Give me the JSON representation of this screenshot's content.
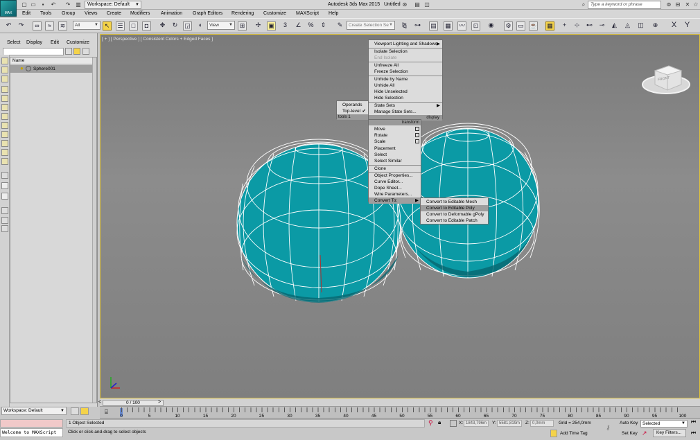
{
  "app": {
    "title": "Autodesk 3ds Max 2015",
    "document": "Untitled",
    "logo_text": "MAX",
    "workspace": "Workspace: Default",
    "keyword_placeholder": "Type a keyword or phrase"
  },
  "menubar": [
    "Edit",
    "Tools",
    "Group",
    "Views",
    "Create",
    "Modifiers",
    "Animation",
    "Graph Editors",
    "Rendering",
    "Customize",
    "MAXScript",
    "Help"
  ],
  "toolbar": {
    "selection_filter": "All",
    "reference_coord": "View",
    "named_selection_placeholder": "Create Selection Se",
    "snap_number": "3"
  },
  "scene_explorer": {
    "menu": [
      "Select",
      "Display",
      "Edit",
      "Customize"
    ],
    "column_name": "Name",
    "objects": [
      "Sphere001"
    ]
  },
  "viewport": {
    "label": "[ + ] [ Perspective ] [ Consistent Colors + Edged Faces ]",
    "viewcube_face": "FRONT",
    "object_color": "#0b9aa5",
    "edge_color": "#ffffff"
  },
  "quad_menu": {
    "display_items": [
      {
        "label": "Viewport Lighting and Shadows",
        "submenu": true
      },
      {
        "label": "Isolate Selection"
      },
      {
        "label": "End Isolate",
        "disabled": true
      },
      {
        "label": "Unfreeze All"
      },
      {
        "label": "Freeze Selection"
      },
      {
        "label": "Unhide by Name"
      },
      {
        "label": "Unhide All"
      },
      {
        "label": "Hide Unselected"
      },
      {
        "label": "Hide Selection"
      },
      {
        "label": "State Sets",
        "submenu": true
      },
      {
        "label": "Manage State Sets..."
      }
    ],
    "tools1_items": [
      {
        "label": "Operands"
      },
      {
        "label": "Top-level",
        "checked": true
      }
    ],
    "tools1_title": "tools 1",
    "display_title": "display",
    "transform_title": "transform",
    "transform_items": [
      {
        "label": "Move"
      },
      {
        "label": "Rotate"
      },
      {
        "label": "Scale"
      },
      {
        "label": "Placement"
      },
      {
        "label": "Select"
      },
      {
        "label": "Select Similar"
      },
      {
        "label": "Clone"
      },
      {
        "label": "Object Properties..."
      },
      {
        "label": "Curve Editor..."
      },
      {
        "label": "Dope Sheet..."
      },
      {
        "label": "Wire Parameters..."
      },
      {
        "label": "Convert To:",
        "submenu": true
      }
    ],
    "convert_items": [
      {
        "label": "Convert to Editable Mesh"
      },
      {
        "label": "Convert to Editable Poly"
      },
      {
        "label": "Convert to Deformable gPoly"
      },
      {
        "label": "Convert to Editable Patch"
      }
    ]
  },
  "timeline": {
    "frame_display": "0 / 100",
    "ticks": [
      "0",
      "5",
      "10",
      "15",
      "20",
      "25",
      "30",
      "35",
      "40",
      "45",
      "50",
      "55",
      "60",
      "65",
      "70",
      "75",
      "80",
      "85",
      "90",
      "95",
      "100"
    ]
  },
  "status": {
    "workspace": "Workspace: Default",
    "maxscript_output": "Welcome to MAXScript",
    "selection_info": "1 Object Selected",
    "prompt": "Click or click-and-drag to select objects",
    "x_label": "X:",
    "x_value": "1843,796m",
    "y_label": "Y:",
    "y_value": "5581,819m",
    "z_label": "Z:",
    "z_value": "0,0mm",
    "grid": "Grid = 254,0mm",
    "add_time_tag": "Add Time Tag",
    "auto_key": "Auto Key",
    "set_key": "Set Key",
    "key_mode": "Selected",
    "key_filters": "Key Filters..."
  }
}
